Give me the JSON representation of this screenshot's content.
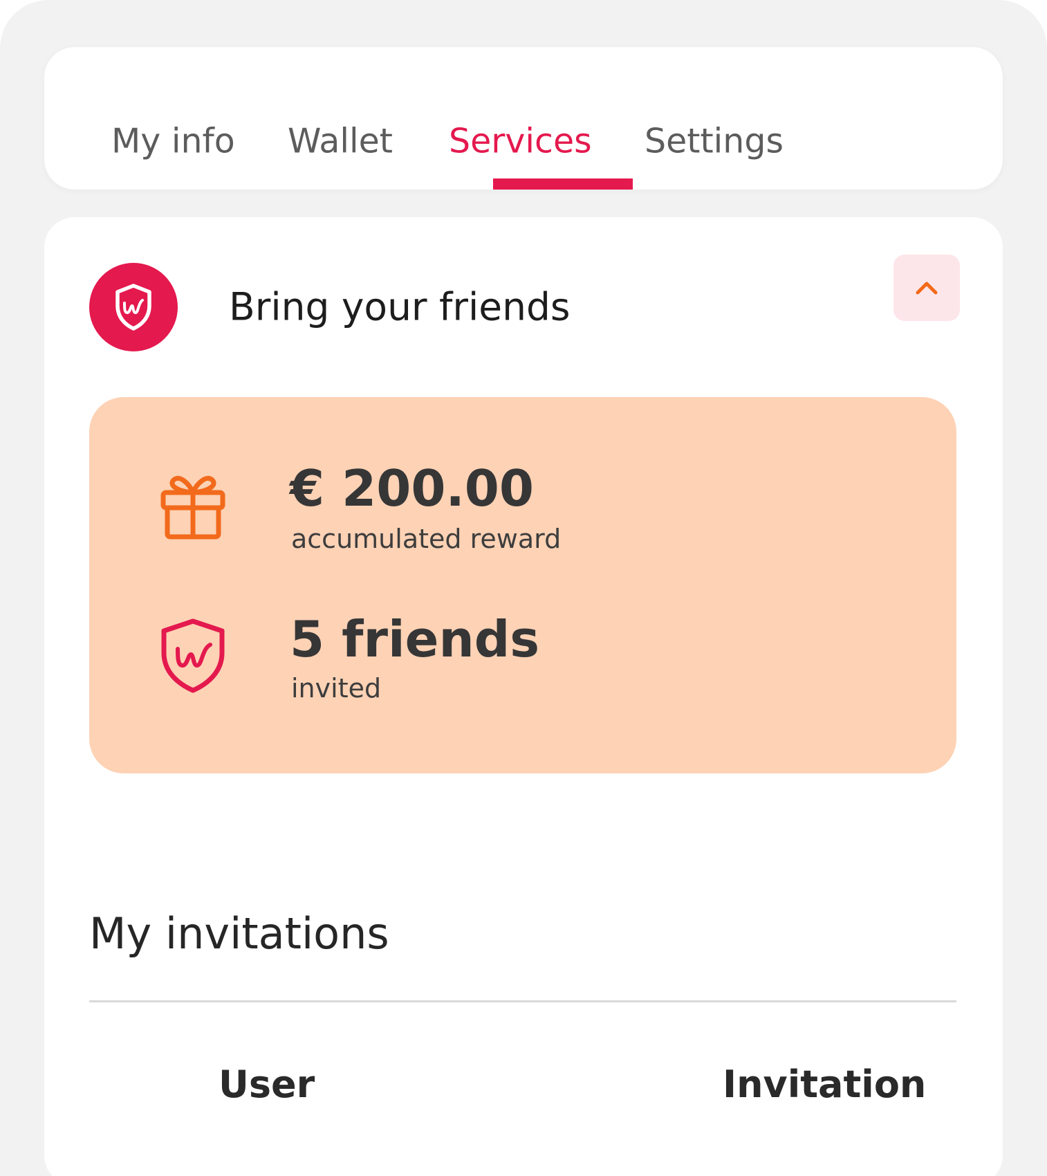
{
  "tabs": [
    {
      "label": "My info",
      "active": false
    },
    {
      "label": "Wallet",
      "active": false
    },
    {
      "label": "Services",
      "active": true
    },
    {
      "label": "Settings",
      "active": false
    }
  ],
  "section": {
    "icon": "shield-logo-icon",
    "title": "Bring your friends",
    "collapse_icon": "chevron-up-icon"
  },
  "stats": {
    "reward": {
      "icon": "gift-icon",
      "value": "€ 200.00",
      "label": "accumulated reward"
    },
    "friends": {
      "icon": "shield-logo-icon",
      "value": "5 friends",
      "label": "invited"
    }
  },
  "invitations": {
    "title": "My invitations",
    "columns": [
      "User",
      "Invitation"
    ]
  },
  "colors": {
    "accent": "#e4194e",
    "orange": "#f26a1b",
    "stats_bg": "#fdd2b5",
    "collapse_bg": "#fde6ea",
    "page_bg": "#f2f2f2"
  }
}
